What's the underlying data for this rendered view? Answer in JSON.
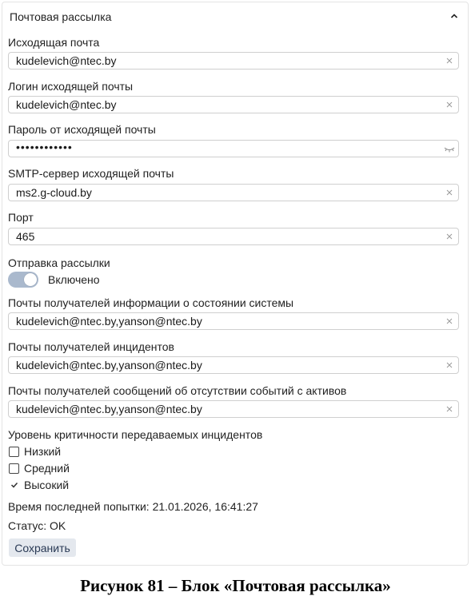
{
  "panel": {
    "title": "Почтовая рассылка",
    "collapse_icon": "chevron-up-icon"
  },
  "fields": {
    "outgoing_email": {
      "label": "Исходящая почта",
      "value": "kudelevich@ntec.by"
    },
    "outgoing_login": {
      "label": "Логин исходящей почты",
      "value": "kudelevich@ntec.by"
    },
    "outgoing_password": {
      "label": "Пароль от исходящей почты",
      "value": "••••••••••••"
    },
    "smtp_server": {
      "label": "SMTP-сервер исходящей почты",
      "value": "ms2.g-cloud.by"
    },
    "port": {
      "label": "Порт",
      "value": "465"
    },
    "system_status_recipients": {
      "label": "Почты получателей информации о состоянии системы",
      "value": "kudelevich@ntec.by,yanson@ntec.by"
    },
    "incident_recipients": {
      "label": "Почты получателей инцидентов",
      "value": "kudelevich@ntec.by,yanson@ntec.by"
    },
    "no_events_recipients": {
      "label": "Почты получателей сообщений об отсутствии событий с активов",
      "value": "kudelevich@ntec.by,yanson@ntec.by"
    }
  },
  "mailing": {
    "label": "Отправка рассылки",
    "toggle_label": "Включено",
    "enabled": true
  },
  "severity": {
    "label": "Уровень критичности передаваемых инцидентов",
    "options": [
      {
        "label": "Низкий",
        "checked": false
      },
      {
        "label": "Средний",
        "checked": false
      },
      {
        "label": "Высокий",
        "checked": true
      }
    ]
  },
  "last_attempt": "Время последней попытки: 21.01.2026, 16:41:27",
  "status": "Статус: OK",
  "save_label": "Сохранить",
  "caption": "Рисунок 81 – Блок «Почтовая рассылка»",
  "colors": {
    "toggle_on": "#aab9cd",
    "save_button_bg": "#e4e8ee",
    "border": "#cfcfcf"
  }
}
